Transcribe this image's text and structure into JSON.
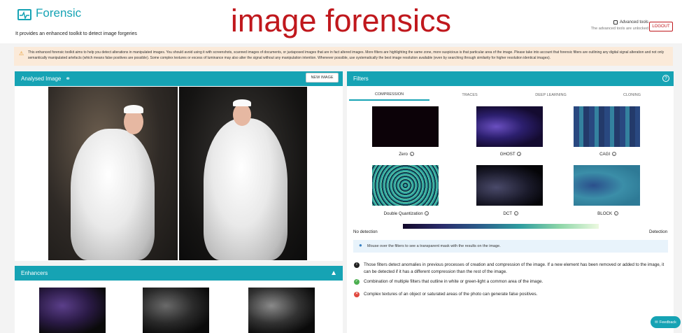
{
  "header": {
    "app_title": "Forensic",
    "subtitle": "It provides an enhanced toolkit to detect image forgeries",
    "overlay_title": "image forensics",
    "advanced_tools_label": "Advanced tools",
    "advanced_tools_note": "The advanced tools are unlocked",
    "logout_label": "LOGOUT"
  },
  "banner": {
    "text": "This enhanced forensic toolkit aims to help you detect alterations in manipulated images. You should avoid using it with screenshots, scanned images of documents, or juxtaposed images that are in fact altered images. More filters are highlighting the same zone, more suspicious is that particular area of the image. Please take into account that forensic filters are outlining any digital signal alteration and not only semantically manipulated artefacts (which means false positives are possible). Some complex textures or excess of luminance may also alter the signal without any manipulation intention. Whenever possible, use systematically the best image resolution available (even by searching through similarity for higher resolution identical images)."
  },
  "analysed": {
    "title": "Analysed Image",
    "new_image_label": "NEW IMAGE"
  },
  "filters": {
    "title": "Filters",
    "tabs": [
      "COMPRESSION",
      "TRACES",
      "DEEP LEARNING",
      "CLONING"
    ],
    "active_tab": 0,
    "items": [
      {
        "label": "Zero"
      },
      {
        "label": "GHOST"
      },
      {
        "label": "CAGI"
      },
      {
        "label": "Double Quantization"
      },
      {
        "label": "DCT"
      },
      {
        "label": "BLOCK"
      }
    ],
    "scale_min_label": "No detection",
    "scale_max_label": "Detection",
    "mouse_hint": "Mouse over the filters to see a transparent mask with the results on the image.",
    "notes": [
      {
        "icon": "info-icon",
        "color": "#222222",
        "text": "Those filters detect anomalies in previous processes of creation and compression of the image. If a new element has been removed or added to the image, it can be detected if it has a different compression than the rest of the image."
      },
      {
        "icon": "check-icon",
        "color": "#4caf50",
        "text": "Combination of multiple filters that outline in white or green-light a common area of the image."
      },
      {
        "icon": "cross-icon",
        "color": "#e0483e",
        "text": "Complex textures of an object or saturated areas of the photo can generate false positives."
      }
    ]
  },
  "enhancers": {
    "title": "Enhancers"
  },
  "feedback_label": "Feedback",
  "colors": {
    "accent": "#16a3b4",
    "danger": "#c0181d",
    "banner_bg": "#fbead9"
  }
}
